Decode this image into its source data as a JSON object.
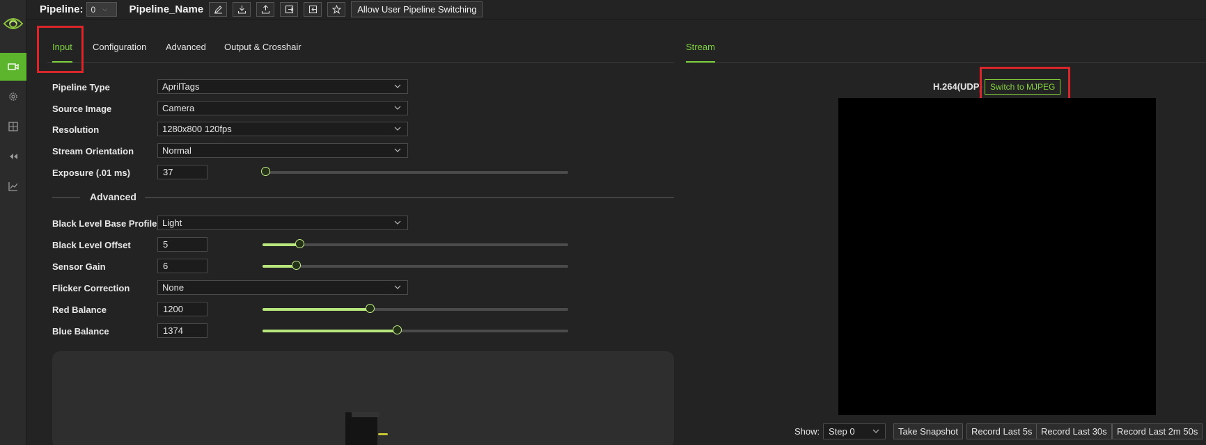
{
  "topbar": {
    "pipeline_label": "Pipeline:",
    "pipeline_index": "0",
    "pipeline_name": "Pipeline_Name",
    "icon_buttons": [
      "edit-icon",
      "download-icon",
      "upload-icon",
      "export-icon",
      "import-icon",
      "star-icon"
    ],
    "allow_switching_label": "Allow User Pipeline Switching"
  },
  "sidebar": {
    "items": [
      {
        "icon": "camera-icon",
        "active": true
      },
      {
        "icon": "gear-icon",
        "active": false
      },
      {
        "icon": "dashboard-icon",
        "active": false
      },
      {
        "icon": "rewind-icon",
        "active": false
      },
      {
        "icon": "chart-icon",
        "active": false
      }
    ]
  },
  "tabs": {
    "input": "Input",
    "configuration": "Configuration",
    "advanced": "Advanced",
    "output": "Output & Crosshair",
    "active": "Input"
  },
  "stream_tab": "Stream",
  "input": {
    "pipeline_type": {
      "label": "Pipeline Type",
      "value": "AprilTags"
    },
    "source_image": {
      "label": "Source Image",
      "value": "Camera"
    },
    "resolution": {
      "label": "Resolution",
      "value": "1280x800 120fps"
    },
    "stream_orientation": {
      "label": "Stream Orientation",
      "value": "Normal"
    },
    "exposure": {
      "label": "Exposure (.01 ms)",
      "value": "37",
      "slider_fraction": 0.01
    }
  },
  "advanced_section": {
    "title": "Advanced",
    "black_level_profile": {
      "label": "Black Level Base Profile",
      "value": "Light"
    },
    "black_level_offset": {
      "label": "Black Level Offset",
      "value": "5",
      "slider_fraction": 0.12
    },
    "sensor_gain": {
      "label": "Sensor Gain",
      "value": "6",
      "slider_fraction": 0.11
    },
    "flicker_correction": {
      "label": "Flicker Correction",
      "value": "None"
    },
    "red_balance": {
      "label": "Red Balance",
      "value": "1200",
      "slider_fraction": 0.35
    },
    "blue_balance": {
      "label": "Blue Balance",
      "value": "1374",
      "slider_fraction": 0.44
    }
  },
  "stream": {
    "codec": "H.264(UDP)",
    "switch_label": "Switch to MJPEG",
    "show_label": "Show:",
    "show_value": "Step 0",
    "snapshot": "Take Snapshot",
    "record_5s": "Record Last 5s",
    "record_30s": "Record Last 30s",
    "record_2m": "Record Last 2m 50s"
  },
  "colors": {
    "accent": "#7fd33f",
    "highlight": "#d8262b",
    "background": "#232323"
  }
}
